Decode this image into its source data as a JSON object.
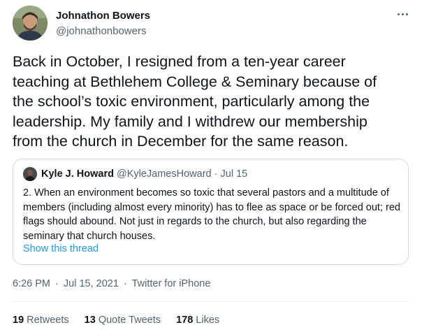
{
  "author": {
    "name": "Johnathon Bowers",
    "handle": "@johnathonbowers",
    "avatar_icon": "person-photo-icon",
    "more_icon": "more-dots-icon"
  },
  "tweet": {
    "text": "Back in October, I resigned from a ten-year career\nteaching at Bethlehem College & Seminary because of\nthe school’s toxic environment, particularly among the\nleadership. My family and I withdrew our membership\nfrom the church in December for the same reason."
  },
  "quote": {
    "name": "Kyle J. Howard",
    "handle": "@KyleJamesHoward",
    "separator": "·",
    "date": "Jul 15",
    "text": "2. When an environment becomes so toxic that several pastors and a multitude of members (including almost every minority) has to flee as space or be forced out; red flags should abound. Not just in regards to the church, but also regarding the seminary that church houses.",
    "show_thread": "Show this thread"
  },
  "meta": {
    "time": "6:26 PM",
    "date": "Jul 15, 2021",
    "separator": "·",
    "source": "Twitter for iPhone"
  },
  "stats": {
    "retweets_count": "19",
    "retweets_label": "Retweets",
    "quotes_count": "13",
    "quotes_label": "Quote Tweets",
    "likes_count": "178",
    "likes_label": "Likes"
  },
  "colors": {
    "text": "#0f1419",
    "secondary": "#536471",
    "link": "#1d9bf0",
    "border": "#cfd9de"
  }
}
